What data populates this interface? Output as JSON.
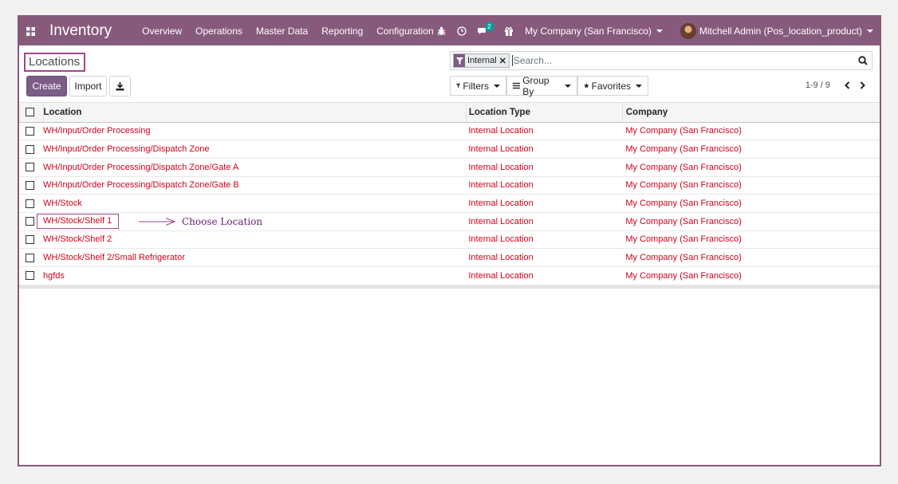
{
  "navbar": {
    "app_title": "Inventory",
    "menu": [
      "Overview",
      "Operations",
      "Master Data",
      "Reporting",
      "Configuration"
    ],
    "chat_badge": "2",
    "company": "My Company (San Francisco)",
    "user": "Mitchell Admin (Pos_location_product)"
  },
  "breadcrumb": "Locations",
  "buttons": {
    "create": "Create",
    "import": "Import"
  },
  "search": {
    "facet": "Internal",
    "placeholder": "Search..."
  },
  "filters": {
    "filters": "Filters",
    "group_by": "Group By",
    "favorites": "Favorites"
  },
  "pager": "1-9 / 9",
  "table": {
    "headers": [
      "Location",
      "Location Type",
      "Company"
    ],
    "rows": [
      {
        "location": "WH/Input/Order Processing",
        "type": "Internal Location",
        "company": "My Company (San Francisco)"
      },
      {
        "location": "WH/Input/Order Processing/Dispatch Zone",
        "type": "Internal Location",
        "company": "My Company (San Francisco)"
      },
      {
        "location": "WH/Input/Order Processing/Dispatch Zone/Gate A",
        "type": "Internal Location",
        "company": "My Company (San Francisco)"
      },
      {
        "location": "WH/Input/Order Processing/Dispatch Zone/Gate B",
        "type": "Internal Location",
        "company": "My Company (San Francisco)"
      },
      {
        "location": "WH/Stock",
        "type": "Internal Location",
        "company": "My Company (San Francisco)"
      },
      {
        "location": "WH/Stock/Shelf 1",
        "type": "Internal Location",
        "company": "My Company (San Francisco)"
      },
      {
        "location": "WH/Stock/Shelf 2",
        "type": "Internal Location",
        "company": "My Company (San Francisco)"
      },
      {
        "location": "WH/Stock/Shelf 2/Small Refrigerator",
        "type": "Internal Location",
        "company": "My Company (San Francisco)"
      },
      {
        "location": "hgfds",
        "type": "Internal Location",
        "company": "My Company (San Francisco)"
      }
    ]
  },
  "annotation": "Choose Location",
  "colors": {
    "brand": "#875A7B",
    "link": "#d0021b",
    "highlight": "#a24689"
  },
  "icons": [
    "apps-icon",
    "bug-icon",
    "clock-icon",
    "chat-icon",
    "gift-icon",
    "filter-icon",
    "search-icon",
    "download-icon",
    "star-icon",
    "list-icon",
    "chevron-left-icon",
    "chevron-right-icon"
  ]
}
